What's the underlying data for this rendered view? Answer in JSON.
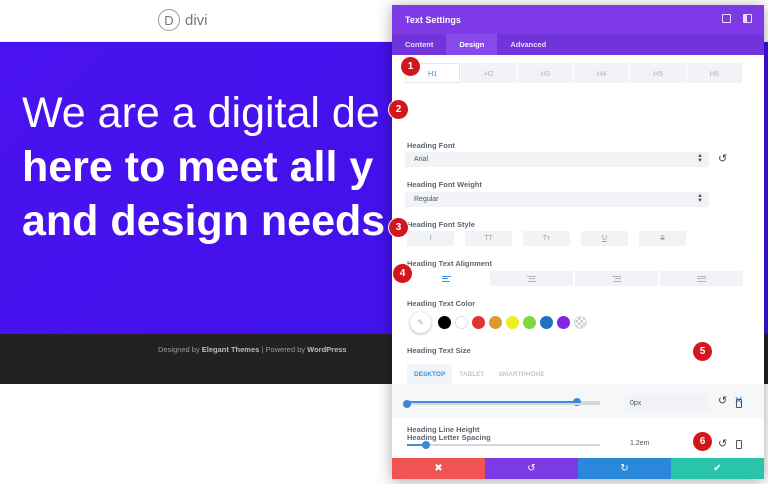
{
  "site": {
    "logo_letter": "D",
    "logo_text": "divi",
    "hero_lines": [
      "We are a digital de",
      "here to meet all y",
      "and design needs"
    ],
    "footer": {
      "prefix": "Designed by ",
      "brand": "Elegant Themes",
      "middle": " | Powered by ",
      "platform": "WordPress"
    }
  },
  "modal": {
    "title": "Text Settings",
    "tabs": [
      "Content",
      "Design",
      "Advanced"
    ],
    "active_tab": "Design",
    "heading_levels": [
      "H1",
      "H2",
      "H3",
      "H4",
      "H5",
      "H6"
    ],
    "heading_font": {
      "label": "Heading Font",
      "value": "Arial"
    },
    "heading_font_weight": {
      "label": "Heading Font Weight",
      "value": "Regular"
    },
    "heading_font_style": {
      "label": "Heading Font Style",
      "options": [
        "I",
        "TT",
        "Tт",
        "U",
        "S"
      ]
    },
    "heading_text_alignment": {
      "label": "Heading Text Alignment",
      "options": [
        "left",
        "center",
        "right",
        "justify"
      ],
      "active": "left"
    },
    "heading_text_color": {
      "label": "Heading Text Color",
      "swatches": [
        "#000000",
        "#ffffff",
        "#dd3333",
        "#dd9933",
        "#eeee22",
        "#81d742",
        "#1e73be",
        "#8224e3",
        "transparent"
      ]
    },
    "heading_text_size": {
      "label": "Heading Text Size",
      "devices": [
        "DESKTOP",
        "TABLET",
        "SMARTPHONE"
      ],
      "active_device": "DESKTOP",
      "value": "86px",
      "fraction": 0.88
    },
    "heading_letter_spacing": {
      "label": "Heading Letter Spacing",
      "value": "0px",
      "fraction": 0.0
    },
    "heading_line_height": {
      "label": "Heading Line Height",
      "value": "1.2em",
      "fraction": 0.1
    },
    "footer_buttons": [
      "cancel",
      "undo",
      "redo",
      "save"
    ],
    "colors": {
      "header": "#7d3ae6",
      "tabs": "#7034da",
      "cancel": "#ef5352",
      "undo": "#7c3ae5",
      "redo": "#2b87da",
      "save": "#29c4a9"
    }
  },
  "annotations": [
    "1",
    "2",
    "3",
    "4",
    "5",
    "6"
  ]
}
